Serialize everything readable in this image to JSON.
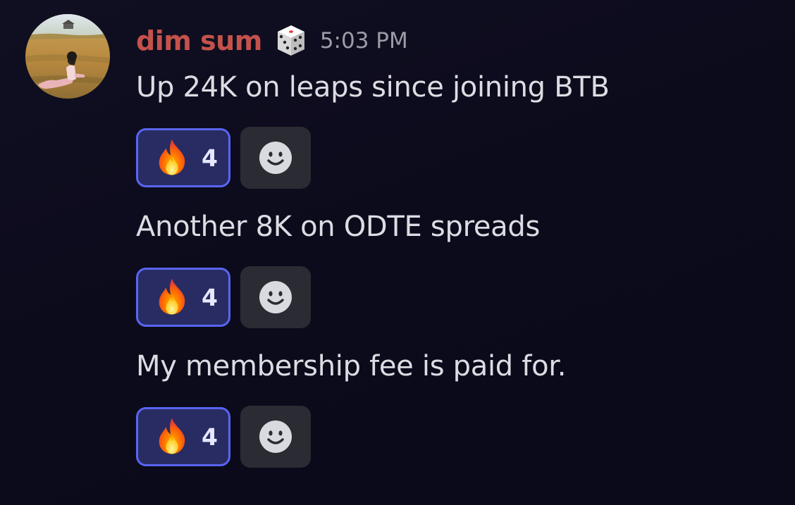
{
  "author": {
    "username": "dim sum",
    "badge_icon": "dice-icon",
    "timestamp": "5:03 PM",
    "avatar_icon": "avatar-photo",
    "username_color": "#c4524b"
  },
  "messages": [
    {
      "text": "Up 24K on leaps since joining BTB",
      "reaction": {
        "emoji_icon": "fire-emoji-icon",
        "count": "4"
      },
      "add_reaction_icon": "smiley-face-icon"
    },
    {
      "text": "Another 8K on ODTE spreads",
      "reaction": {
        "emoji_icon": "fire-emoji-icon",
        "count": "4"
      },
      "add_reaction_icon": "smiley-face-icon"
    },
    {
      "text": "My membership fee is paid for.",
      "reaction": {
        "emoji_icon": "fire-emoji-icon",
        "count": "4"
      },
      "add_reaction_icon": "smiley-face-icon"
    }
  ],
  "colors": {
    "reaction_border": "#5865f2",
    "reaction_background": "#282c63",
    "add_reaction_background": "#2a2b33",
    "text": "#dcdde3",
    "timestamp": "#9a9ca6"
  }
}
